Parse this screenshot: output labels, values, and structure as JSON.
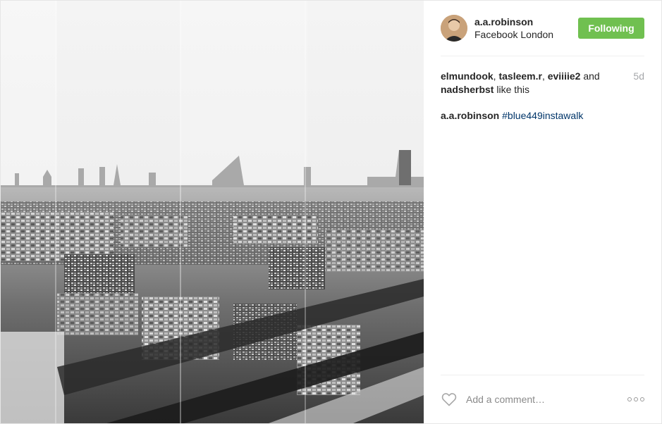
{
  "post": {
    "photo_alt": "",
    "author": {
      "username": "a.a.robinson",
      "location": "Facebook London",
      "avatar_icon": "user-avatar"
    },
    "follow_button_label": "Following",
    "follow_color": "#70c050",
    "likes": {
      "likers": [
        "elmundook",
        "tasleem.r",
        "eviiiie2"
      ],
      "conjunction": "and",
      "last_liker": "nadsherbst",
      "suffix": "like this"
    },
    "time_ago": "5d",
    "caption": {
      "username": "a.a.robinson",
      "hashtag": "#blue449instawalk"
    },
    "comment_placeholder": "Add a comment…",
    "icons": {
      "like": "heart-icon",
      "more": "more-options-icon"
    }
  }
}
